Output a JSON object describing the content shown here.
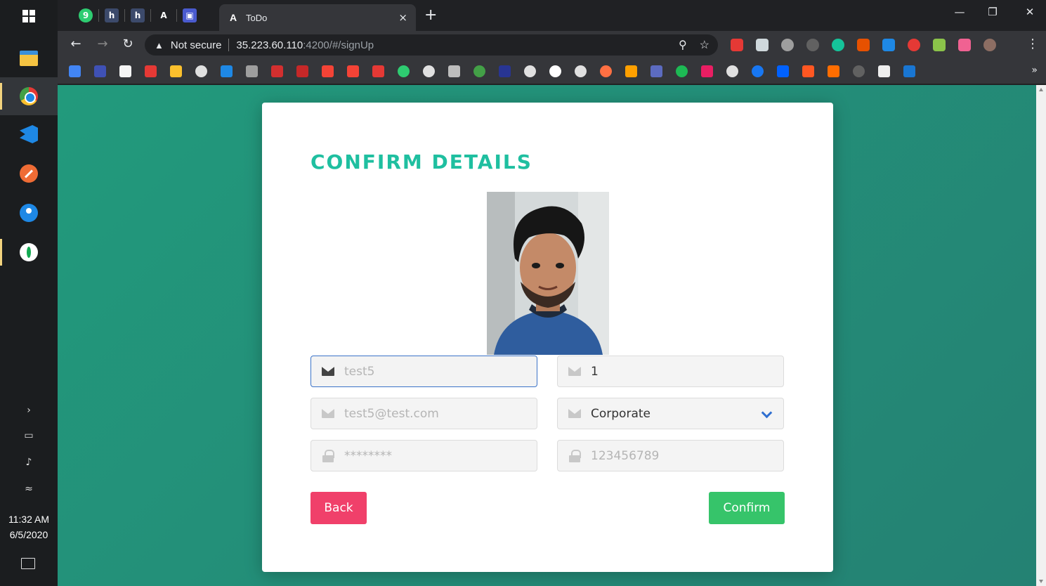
{
  "taskbar": {
    "clock_time": "11:32 AM",
    "clock_date": "6/5/2020",
    "apps": [
      "file-explorer",
      "chrome",
      "vscode",
      "postman",
      "sourcetree",
      "mongodb-compass"
    ]
  },
  "browser": {
    "tab_title": "ToDo",
    "tab_close": "×",
    "new_tab": "+",
    "security_label": "Not secure",
    "url_host": "35.223.60.110",
    "url_rest": ":4200/#/signUp",
    "bookmarks_more": "»"
  },
  "page": {
    "title": "CONFIRM DETAILS",
    "fields": {
      "username": "test5",
      "number": "1",
      "email": "test5@test.com",
      "account_type": "Corporate",
      "password": "********",
      "phone": "123456789"
    },
    "back_label": "Back",
    "confirm_label": "Confirm"
  },
  "colors": {
    "title": "#1fbfa0",
    "background_start": "#229a7c",
    "background_end": "#248173",
    "back_button": "#f0406a",
    "confirm_button": "#36c46a",
    "focus_border": "#3b73c8"
  }
}
